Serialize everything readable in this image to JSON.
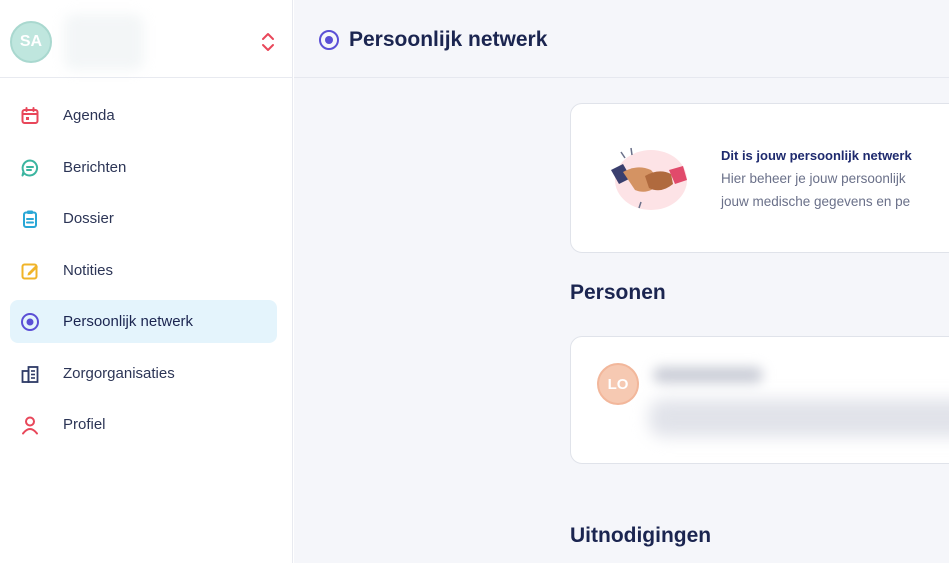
{
  "sidebar": {
    "account": {
      "initials": "SA"
    },
    "items": [
      {
        "label": "Agenda",
        "icon": "calendar-icon",
        "color": "#e8475a",
        "active": false
      },
      {
        "label": "Berichten",
        "icon": "message-icon",
        "color": "#3bb5a0",
        "active": false
      },
      {
        "label": "Dossier",
        "icon": "clipboard-icon",
        "color": "#29a7d6",
        "active": false
      },
      {
        "label": "Notities",
        "icon": "note-icon",
        "color": "#f0b429",
        "active": false
      },
      {
        "label": "Persoonlijk netwerk",
        "icon": "network-icon",
        "color": "#5b4fd6",
        "active": true
      },
      {
        "label": "Zorgorganisaties",
        "icon": "building-icon",
        "color": "#2e3a66",
        "active": false
      },
      {
        "label": "Profiel",
        "icon": "person-icon",
        "color": "#e8475a",
        "active": false
      }
    ]
  },
  "header": {
    "title": "Persoonlijk netwerk"
  },
  "info": {
    "title": "Dit is jouw persoonlijk netwerk",
    "line1": "Hier beheer je jouw persoonlijk",
    "line2": "jouw medische gegevens en pe"
  },
  "sections": {
    "persons": "Personen",
    "invitations": "Uitnodigingen"
  },
  "person": {
    "initials": "LO"
  },
  "colors": {
    "accent": "#5b4fd6",
    "active_bg": "#e4f4fc",
    "main_bg": "#f5f6fa"
  }
}
